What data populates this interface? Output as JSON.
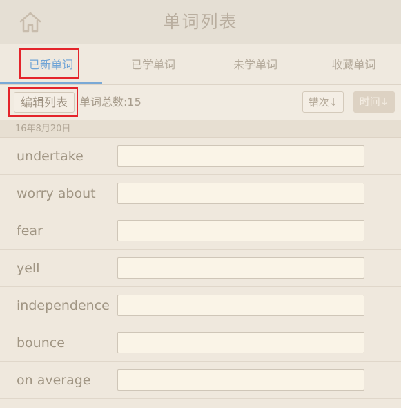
{
  "header": {
    "title": "单词列表",
    "home_icon": "home-icon"
  },
  "tabs": [
    {
      "label": "已新单词",
      "active": true
    },
    {
      "label": "已学单词",
      "active": false
    },
    {
      "label": "未学单词",
      "active": false
    },
    {
      "label": "收藏单词",
      "active": false
    }
  ],
  "toolbar": {
    "edit_label": "编辑列表",
    "total_label": "单词总数:15",
    "error_sort_label": "错次↓",
    "time_sort_label": "时间↓"
  },
  "date_group": {
    "label": "16年8月20日"
  },
  "words": [
    {
      "word": "undertake",
      "meaning": ""
    },
    {
      "word": "worry about",
      "meaning": ""
    },
    {
      "word": "fear",
      "meaning": ""
    },
    {
      "word": "yell",
      "meaning": ""
    },
    {
      "word": "independence",
      "meaning": ""
    },
    {
      "word": "bounce",
      "meaning": ""
    },
    {
      "word": "on average",
      "meaning": ""
    }
  ],
  "colors": {
    "accent": "#6fa4d6",
    "highlight": "#e4242b",
    "background": "#efe8dd"
  }
}
